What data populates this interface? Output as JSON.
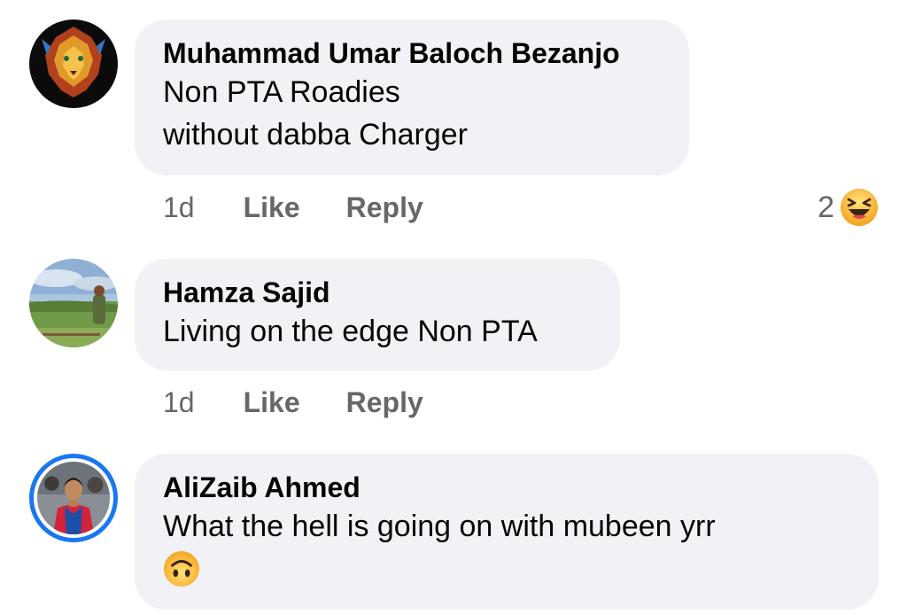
{
  "comments": [
    {
      "author": "Muhammad Umar Baloch Bezanjo",
      "text_lines": [
        "Non PTA Roadies",
        "without dabba Charger"
      ],
      "time": "1d",
      "like_label": "Like",
      "reply_label": "Reply",
      "reaction_count": "2",
      "reaction_icon": "laughing-emoji-icon"
    },
    {
      "author": "Hamza Sajid",
      "text_lines": [
        "Living on the edge Non PTA"
      ],
      "time": "1d",
      "like_label": "Like",
      "reply_label": "Reply"
    },
    {
      "author": "AliZaib Ahmed",
      "text_lines": [
        "What the hell is going on with mubeen yrr"
      ],
      "trailing_icon": "upside-down-face-emoji-icon"
    }
  ],
  "colors": {
    "bubble": "#f0f2f5",
    "meta_text": "#65676b",
    "story_ring": "#1877f2"
  }
}
